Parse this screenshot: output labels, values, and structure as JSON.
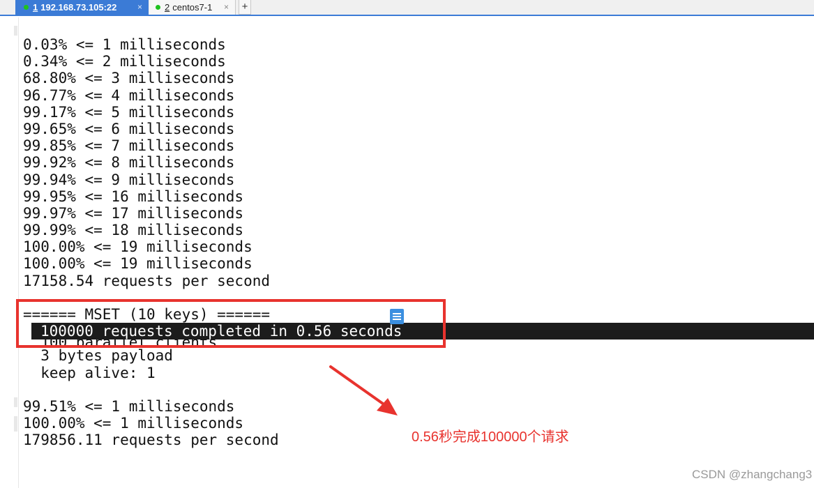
{
  "tabs": [
    {
      "num": "1",
      "title": "192.168.73.105:22",
      "close": "×",
      "active": true
    },
    {
      "num": "2",
      "title": "centos7-1",
      "close": "×",
      "active": false
    }
  ],
  "new_tab_label": "+",
  "terminal_lines": [
    {
      "text": "0.03% <= 1 milliseconds"
    },
    {
      "text": "0.34% <= 2 milliseconds"
    },
    {
      "text": "68.80% <= 3 milliseconds"
    },
    {
      "text": "96.77% <= 4 milliseconds"
    },
    {
      "text": "99.17% <= 5 milliseconds"
    },
    {
      "text": "99.65% <= 6 milliseconds"
    },
    {
      "text": "99.85% <= 7 milliseconds"
    },
    {
      "text": "99.92% <= 8 milliseconds"
    },
    {
      "text": "99.94% <= 9 milliseconds"
    },
    {
      "text": "99.95% <= 16 milliseconds"
    },
    {
      "text": "99.97% <= 17 milliseconds"
    },
    {
      "text": "99.99% <= 18 milliseconds"
    },
    {
      "text": "100.00% <= 19 milliseconds"
    },
    {
      "text": "100.00% <= 19 milliseconds"
    },
    {
      "text": "17158.54 requests per second"
    },
    {
      "text": ""
    },
    {
      "text": "====== MSET (10 keys) ======"
    },
    {
      "text": "100000 requests completed in 0.56 seconds",
      "highlight": true
    },
    {
      "text": "  100 parallel clients",
      "partial": true
    },
    {
      "text": "  3 bytes payload"
    },
    {
      "text": "  keep alive: 1"
    },
    {
      "text": ""
    },
    {
      "text": "99.51% <= 1 milliseconds"
    },
    {
      "text": "100.00% <= 1 milliseconds"
    },
    {
      "text": "179856.11 requests per second"
    }
  ],
  "annotation_text": "0.56秒完成100000个请求",
  "watermark": "CSDN @zhangchang3",
  "colors": {
    "tab_active": "#3b7bd6",
    "annotation_red": "#e8332e",
    "status_dot": "#1fc21f",
    "highlight_bg": "#1c1c1c"
  }
}
